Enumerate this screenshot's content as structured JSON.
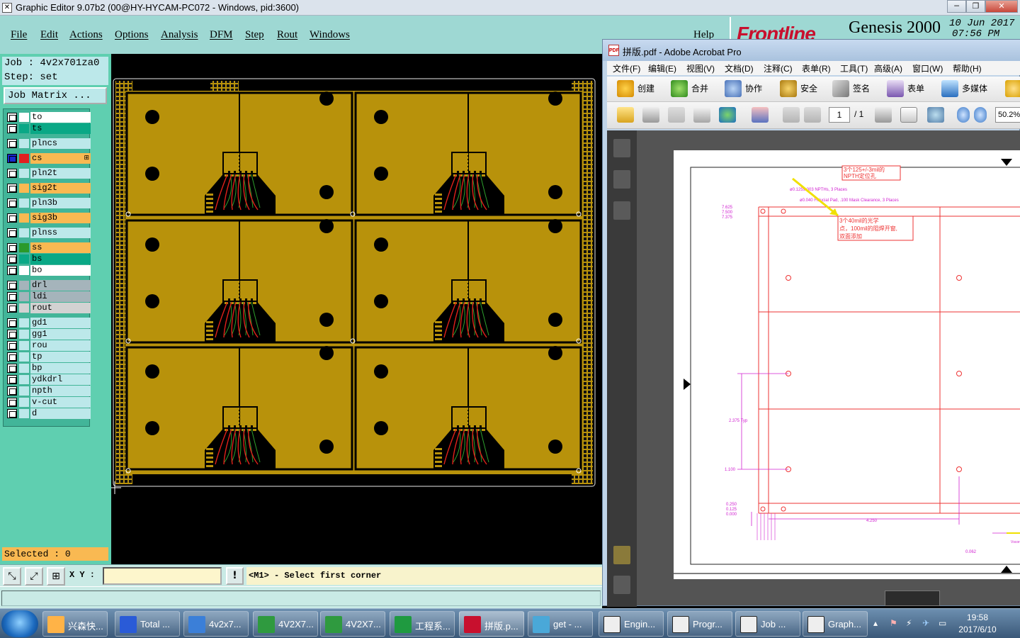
{
  "genesis": {
    "title": "Graphic Editor 9.07b2 (00@HY-HYCAM-PC072 - Windows, pid:3600)",
    "window_buttons": [
      "─",
      "❐",
      "✕"
    ],
    "menu": [
      "File",
      "Edit",
      "Actions",
      "Options",
      "Analysis",
      "DFM",
      "Step",
      "Rout",
      "Windows"
    ],
    "help": "Help",
    "brand": "Frontline",
    "product": "Genesis 2000",
    "date": "10 Jun 2017",
    "time": "07:56 PM",
    "job": "Job : 4v2x701za0",
    "step": "Step: set",
    "job_matrix": "Job Matrix ...",
    "layers": [
      {
        "name": "to",
        "color": "#ffffff"
      },
      {
        "name": "ts",
        "color": "#0aa886"
      },
      {
        "name": "plncs",
        "color": "#bce8ea"
      },
      {
        "name": "cs",
        "color": "#f9b952",
        "active": true
      },
      {
        "name": "pln2t",
        "color": "#bce8ea"
      },
      {
        "name": "sig2t",
        "color": "#f9b952"
      },
      {
        "name": "pln3b",
        "color": "#bce8ea"
      },
      {
        "name": "sig3b",
        "color": "#f9b952"
      },
      {
        "name": "plnss",
        "color": "#bce8ea"
      },
      {
        "name": "ss",
        "color": "#f9b952"
      },
      {
        "name": "bs",
        "color": "#0aa886"
      },
      {
        "name": "bo",
        "color": "#ffffff"
      },
      {
        "name": "drl",
        "color": "#a5b4bb"
      },
      {
        "name": "ldi",
        "color": "#a5b4bb"
      },
      {
        "name": "rout",
        "color": "#d2d2d2"
      },
      {
        "name": "gd1",
        "color": "#bce8ea"
      },
      {
        "name": "gg1",
        "color": "#bce8ea"
      },
      {
        "name": "rou",
        "color": "#bce8ea"
      },
      {
        "name": "tp",
        "color": "#bce8ea"
      },
      {
        "name": "bp",
        "color": "#bce8ea"
      },
      {
        "name": "ydkdrl",
        "color": "#bce8ea"
      },
      {
        "name": "npth",
        "color": "#bce8ea"
      },
      {
        "name": "v-cut",
        "color": "#bce8ea"
      },
      {
        "name": "d",
        "color": "#bce8ea"
      }
    ],
    "selected": "Selected : 0",
    "xy_label": "X Y :",
    "xy_value": "",
    "prompt": "<M1> - Select first corner",
    "colors": {
      "board": "#b8920b",
      "panel": "#5fcfb0",
      "menubar": "#9ed8d3",
      "trace_red": "#e0201a",
      "trace_green": "#2ea02e"
    }
  },
  "acrobat": {
    "title": "拼版.pdf - Adobe Acrobat Pro",
    "menu": [
      "文件(F)",
      "编辑(E)",
      "视图(V)",
      "文档(D)",
      "注释(C)",
      "表单(R)",
      "工具(T)",
      "高级(A)",
      "窗口(W)",
      "帮助(H)"
    ],
    "toolbar1": [
      "创建",
      "合并",
      "协作",
      "安全",
      "签名",
      "表单",
      "多媒体"
    ],
    "page": "1",
    "page_total": "/ 1",
    "zoom": "50.2%",
    "drawing": {
      "note1": [
        "3个125+/-3mil的",
        "NPTH定位孔"
      ],
      "note2": [
        "3个40mil的光学",
        "点，100mil的阻焊开窗,",
        "双面添加"
      ],
      "npth_label": "ø0.125±.003 NPTHs, 3 Places",
      "fid_label": "ø0.040 Fiducial Pad, .100 Mask Clearance, 3 Places",
      "left_dims": [
        "7.625",
        "7.500",
        "7.375"
      ],
      "typ_dim": "2.375 Typ",
      "dim_1100": "1.100",
      "bottom_dims": [
        "0.250",
        "0.125",
        "0.000"
      ],
      "dim_4250": "4.250",
      "dim_0062": "0.062",
      "vscore": "Vscore Detail"
    }
  },
  "taskbar": {
    "tasks": [
      "兴森快...",
      "Total ...",
      "4v2x7...",
      "4V2X7...",
      "4V2X7...",
      "工程系...",
      "拼版.p...",
      "get - ...",
      "Engin...",
      "Progr...",
      "Job ...",
      "Graph..."
    ],
    "time": "19:58",
    "date": "2017/6/10"
  }
}
